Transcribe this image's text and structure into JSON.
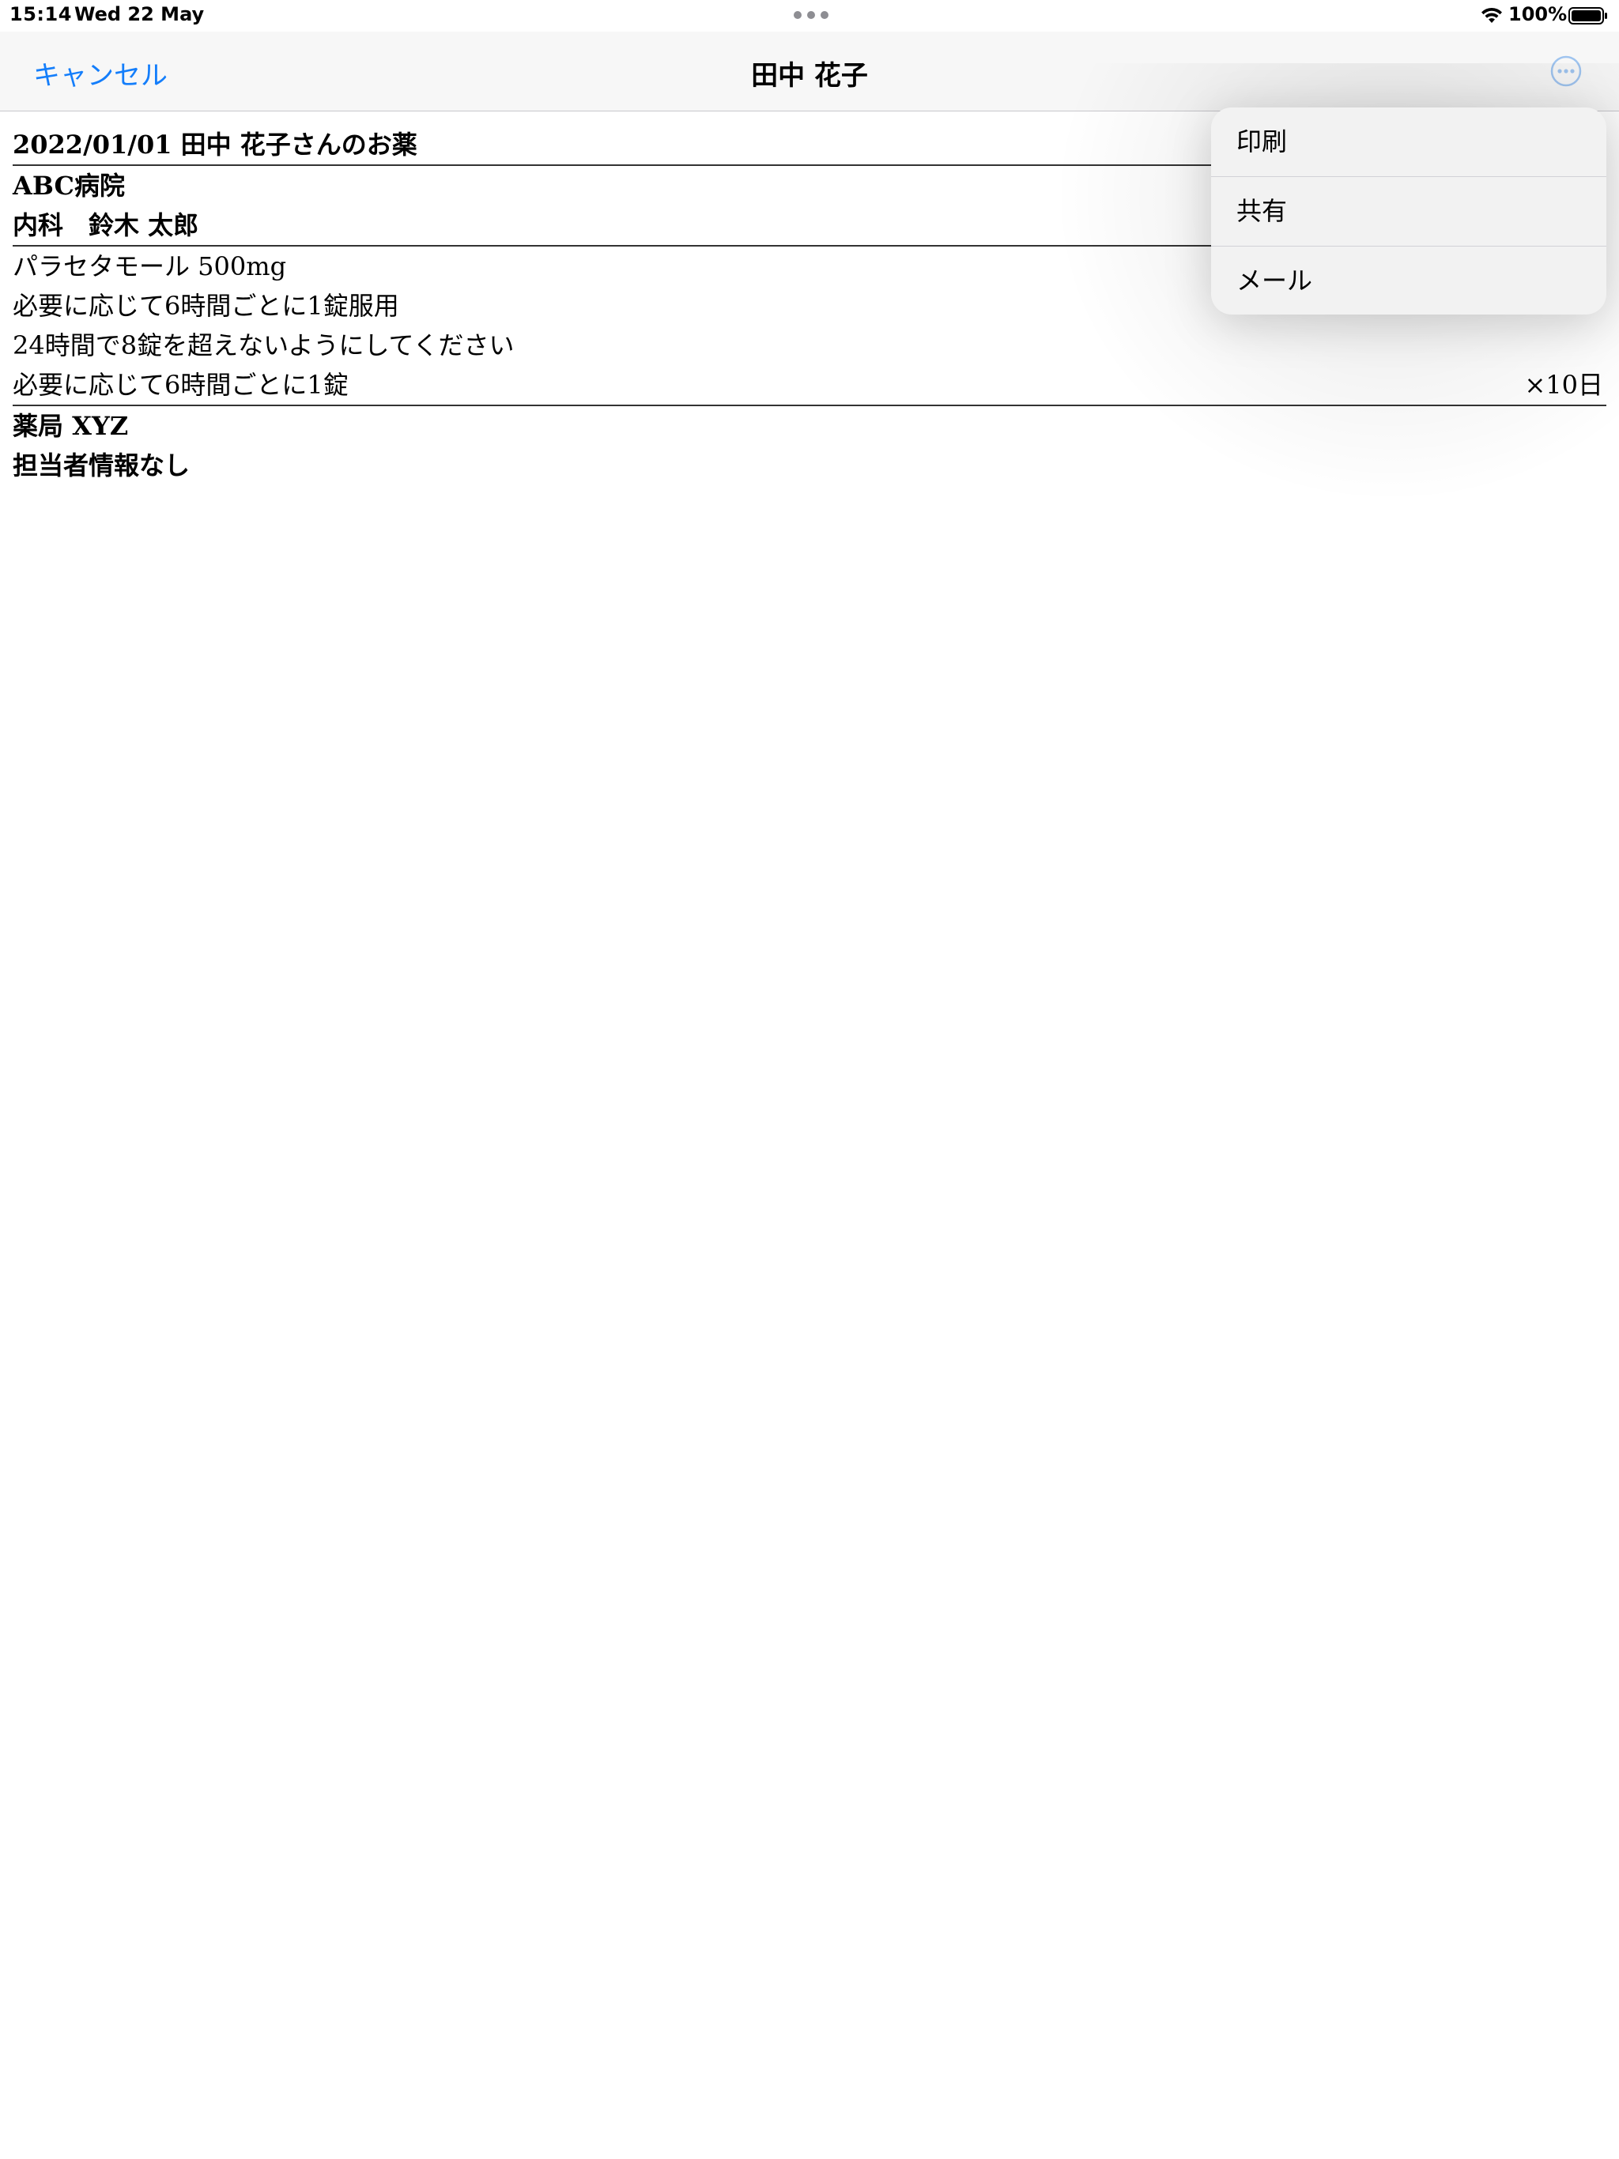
{
  "status_bar": {
    "time": "15:14",
    "date": "Wed 22 May",
    "battery_percent": "100%",
    "icons": [
      "wifi-icon",
      "battery-icon",
      "multitask-dots-icon"
    ]
  },
  "nav_bar": {
    "cancel_label": "キャンセル",
    "title": "田中 花子",
    "more_icon": "ellipsis-circle-icon",
    "accent_color": "#147EFB"
  },
  "document": {
    "header": "2022/01/01 田中 花子さんのお薬",
    "hospital": "ABC病院",
    "department_doctor": "内科　鈴木 太郎",
    "medicine_name": "パラセタモール 500mg",
    "instruction_1": "必要に応じて6時間ごとに1錠服用",
    "instruction_2": "24時間で8錠を超えないようにしてください",
    "dosage": "必要に応じて6時間ごとに1錠",
    "duration": "×10日",
    "pharmacy": "薬局 XYZ",
    "pharmacist": "担当者情報なし"
  },
  "menu": {
    "items": [
      {
        "label": "印刷"
      },
      {
        "label": "共有"
      },
      {
        "label": "メール"
      }
    ]
  }
}
